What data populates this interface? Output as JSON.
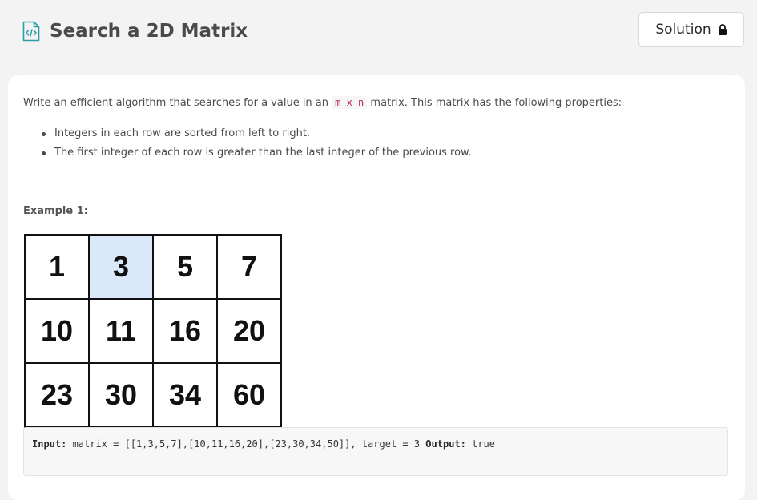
{
  "header": {
    "title": "Search a 2D Matrix",
    "solution_label": "Solution",
    "icon": "code-file-icon",
    "lock_icon": "lock-icon",
    "icon_color": "#2b9ea3"
  },
  "description": {
    "intro_before": "Write an efficient algorithm that searches for a value in an ",
    "intro_code": "m x n",
    "intro_after": " matrix. This matrix has the following properties:",
    "properties": [
      "Integers in each row are sorted from left to right.",
      "The first integer of each row is greater than the last integer of the previous row."
    ]
  },
  "example": {
    "heading": "Example 1:",
    "matrix": [
      [
        "1",
        "3",
        "5",
        "7"
      ],
      [
        "10",
        "11",
        "16",
        "20"
      ],
      [
        "23",
        "30",
        "34",
        "60"
      ]
    ],
    "highlight_value": "3",
    "highlight_color": "#dbe8fa",
    "input_label": "Input:",
    "input_value": " matrix = [[1,3,5,7],[10,11,16,20],[23,30,34,50]], target = 3",
    "output_label": "Output:",
    "output_value": " true"
  }
}
